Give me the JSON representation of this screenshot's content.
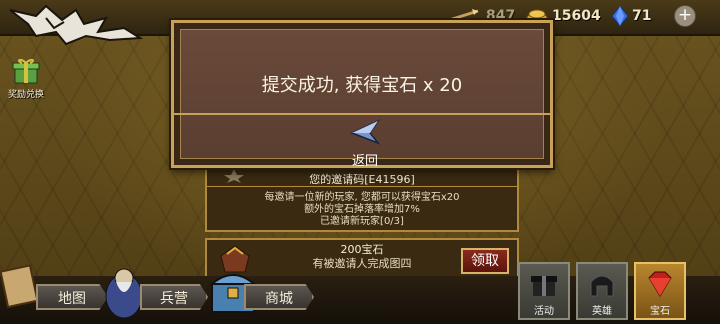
{
  "resources": {
    "arrows": "847",
    "gold": "15604",
    "gems": "71"
  },
  "reward_exchange": {
    "label": "奖励兑换"
  },
  "invite": {
    "code_label": "您的邀请码[E41596]",
    "line1": "每邀请一位新的玩家, 您都可以获得宝石x20",
    "line2": "额外的宝石掉落率增加7%",
    "line3": "已邀请新玩家[0/3]"
  },
  "reward_item": {
    "title": "200宝石",
    "desc": "有被邀请人完成图四",
    "claim_label": "领取"
  },
  "dialog": {
    "message": "提交成功, 获得宝石 x 20",
    "back_label": "返回"
  },
  "nav": {
    "map": "地图",
    "barracks": "兵营",
    "shop": "商城"
  },
  "tabs": {
    "activity": "活动",
    "hero": "英雄",
    "gem": "宝石"
  },
  "colors": {
    "dialog_border": "#c9a25a",
    "gem_blue": "#3a6fd8",
    "active_tab": "#b8862e"
  }
}
